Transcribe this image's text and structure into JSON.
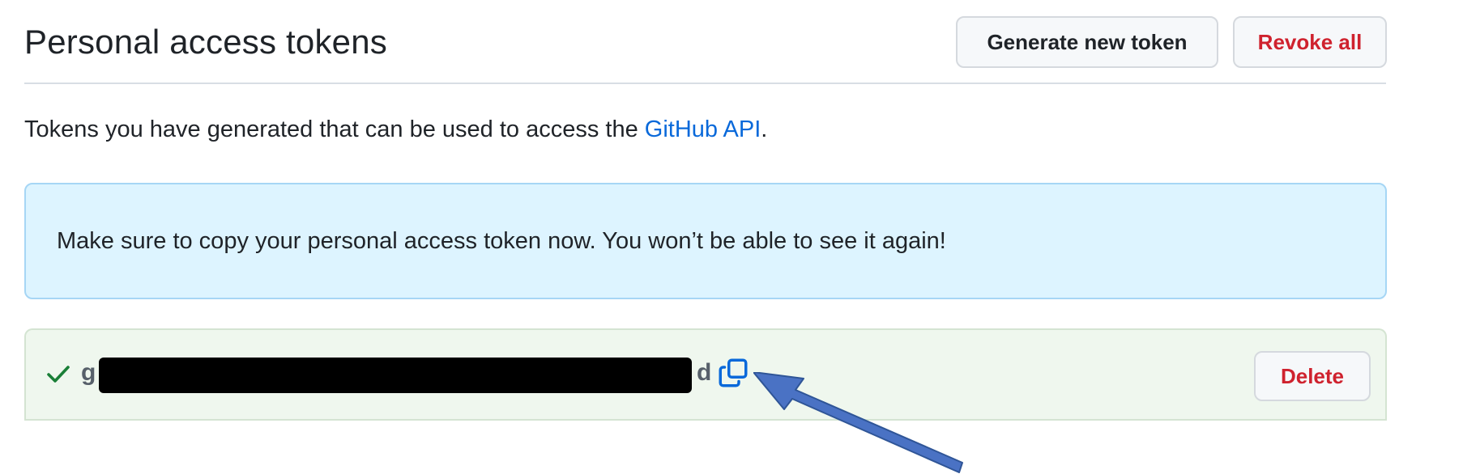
{
  "page": {
    "title": "Personal access tokens",
    "generate_button": "Generate new token",
    "revoke_all_button": "Revoke all"
  },
  "description": {
    "text_before": "Tokens you have generated that can be used to access the ",
    "link_text": "GitHub API",
    "text_after": "."
  },
  "flash": {
    "message": "Make sure to copy your personal access token now. You won’t be able to see it again!"
  },
  "token": {
    "visible_prefix": "g",
    "visible_suffix": "d",
    "delete_button": "Delete",
    "status_icon": "check-icon",
    "copy_icon": "copy-icon"
  },
  "colors": {
    "link": "#0969da",
    "danger": "#cf222e",
    "flash_bg": "#ddf4ff",
    "token_row_bg": "#eff7ee",
    "success": "#1a7f37",
    "annotation_arrow": "#4a72c4"
  }
}
